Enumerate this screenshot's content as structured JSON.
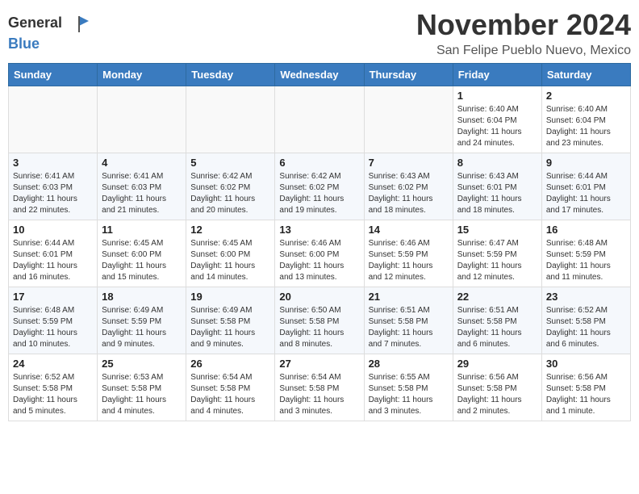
{
  "header": {
    "logo": {
      "line1": "General",
      "line2": "Blue"
    },
    "month": "November 2024",
    "location": "San Felipe Pueblo Nuevo, Mexico"
  },
  "weekdays": [
    "Sunday",
    "Monday",
    "Tuesday",
    "Wednesday",
    "Thursday",
    "Friday",
    "Saturday"
  ],
  "weeks": [
    [
      {
        "day": "",
        "info": ""
      },
      {
        "day": "",
        "info": ""
      },
      {
        "day": "",
        "info": ""
      },
      {
        "day": "",
        "info": ""
      },
      {
        "day": "",
        "info": ""
      },
      {
        "day": "1",
        "info": "Sunrise: 6:40 AM\nSunset: 6:04 PM\nDaylight: 11 hours\nand 24 minutes."
      },
      {
        "day": "2",
        "info": "Sunrise: 6:40 AM\nSunset: 6:04 PM\nDaylight: 11 hours\nand 23 minutes."
      }
    ],
    [
      {
        "day": "3",
        "info": "Sunrise: 6:41 AM\nSunset: 6:03 PM\nDaylight: 11 hours\nand 22 minutes."
      },
      {
        "day": "4",
        "info": "Sunrise: 6:41 AM\nSunset: 6:03 PM\nDaylight: 11 hours\nand 21 minutes."
      },
      {
        "day": "5",
        "info": "Sunrise: 6:42 AM\nSunset: 6:02 PM\nDaylight: 11 hours\nand 20 minutes."
      },
      {
        "day": "6",
        "info": "Sunrise: 6:42 AM\nSunset: 6:02 PM\nDaylight: 11 hours\nand 19 minutes."
      },
      {
        "day": "7",
        "info": "Sunrise: 6:43 AM\nSunset: 6:02 PM\nDaylight: 11 hours\nand 18 minutes."
      },
      {
        "day": "8",
        "info": "Sunrise: 6:43 AM\nSunset: 6:01 PM\nDaylight: 11 hours\nand 18 minutes."
      },
      {
        "day": "9",
        "info": "Sunrise: 6:44 AM\nSunset: 6:01 PM\nDaylight: 11 hours\nand 17 minutes."
      }
    ],
    [
      {
        "day": "10",
        "info": "Sunrise: 6:44 AM\nSunset: 6:01 PM\nDaylight: 11 hours\nand 16 minutes."
      },
      {
        "day": "11",
        "info": "Sunrise: 6:45 AM\nSunset: 6:00 PM\nDaylight: 11 hours\nand 15 minutes."
      },
      {
        "day": "12",
        "info": "Sunrise: 6:45 AM\nSunset: 6:00 PM\nDaylight: 11 hours\nand 14 minutes."
      },
      {
        "day": "13",
        "info": "Sunrise: 6:46 AM\nSunset: 6:00 PM\nDaylight: 11 hours\nand 13 minutes."
      },
      {
        "day": "14",
        "info": "Sunrise: 6:46 AM\nSunset: 5:59 PM\nDaylight: 11 hours\nand 12 minutes."
      },
      {
        "day": "15",
        "info": "Sunrise: 6:47 AM\nSunset: 5:59 PM\nDaylight: 11 hours\nand 12 minutes."
      },
      {
        "day": "16",
        "info": "Sunrise: 6:48 AM\nSunset: 5:59 PM\nDaylight: 11 hours\nand 11 minutes."
      }
    ],
    [
      {
        "day": "17",
        "info": "Sunrise: 6:48 AM\nSunset: 5:59 PM\nDaylight: 11 hours\nand 10 minutes."
      },
      {
        "day": "18",
        "info": "Sunrise: 6:49 AM\nSunset: 5:59 PM\nDaylight: 11 hours\nand 9 minutes."
      },
      {
        "day": "19",
        "info": "Sunrise: 6:49 AM\nSunset: 5:58 PM\nDaylight: 11 hours\nand 9 minutes."
      },
      {
        "day": "20",
        "info": "Sunrise: 6:50 AM\nSunset: 5:58 PM\nDaylight: 11 hours\nand 8 minutes."
      },
      {
        "day": "21",
        "info": "Sunrise: 6:51 AM\nSunset: 5:58 PM\nDaylight: 11 hours\nand 7 minutes."
      },
      {
        "day": "22",
        "info": "Sunrise: 6:51 AM\nSunset: 5:58 PM\nDaylight: 11 hours\nand 6 minutes."
      },
      {
        "day": "23",
        "info": "Sunrise: 6:52 AM\nSunset: 5:58 PM\nDaylight: 11 hours\nand 6 minutes."
      }
    ],
    [
      {
        "day": "24",
        "info": "Sunrise: 6:52 AM\nSunset: 5:58 PM\nDaylight: 11 hours\nand 5 minutes."
      },
      {
        "day": "25",
        "info": "Sunrise: 6:53 AM\nSunset: 5:58 PM\nDaylight: 11 hours\nand 4 minutes."
      },
      {
        "day": "26",
        "info": "Sunrise: 6:54 AM\nSunset: 5:58 PM\nDaylight: 11 hours\nand 4 minutes."
      },
      {
        "day": "27",
        "info": "Sunrise: 6:54 AM\nSunset: 5:58 PM\nDaylight: 11 hours\nand 3 minutes."
      },
      {
        "day": "28",
        "info": "Sunrise: 6:55 AM\nSunset: 5:58 PM\nDaylight: 11 hours\nand 3 minutes."
      },
      {
        "day": "29",
        "info": "Sunrise: 6:56 AM\nSunset: 5:58 PM\nDaylight: 11 hours\nand 2 minutes."
      },
      {
        "day": "30",
        "info": "Sunrise: 6:56 AM\nSunset: 5:58 PM\nDaylight: 11 hours\nand 1 minute."
      }
    ]
  ]
}
